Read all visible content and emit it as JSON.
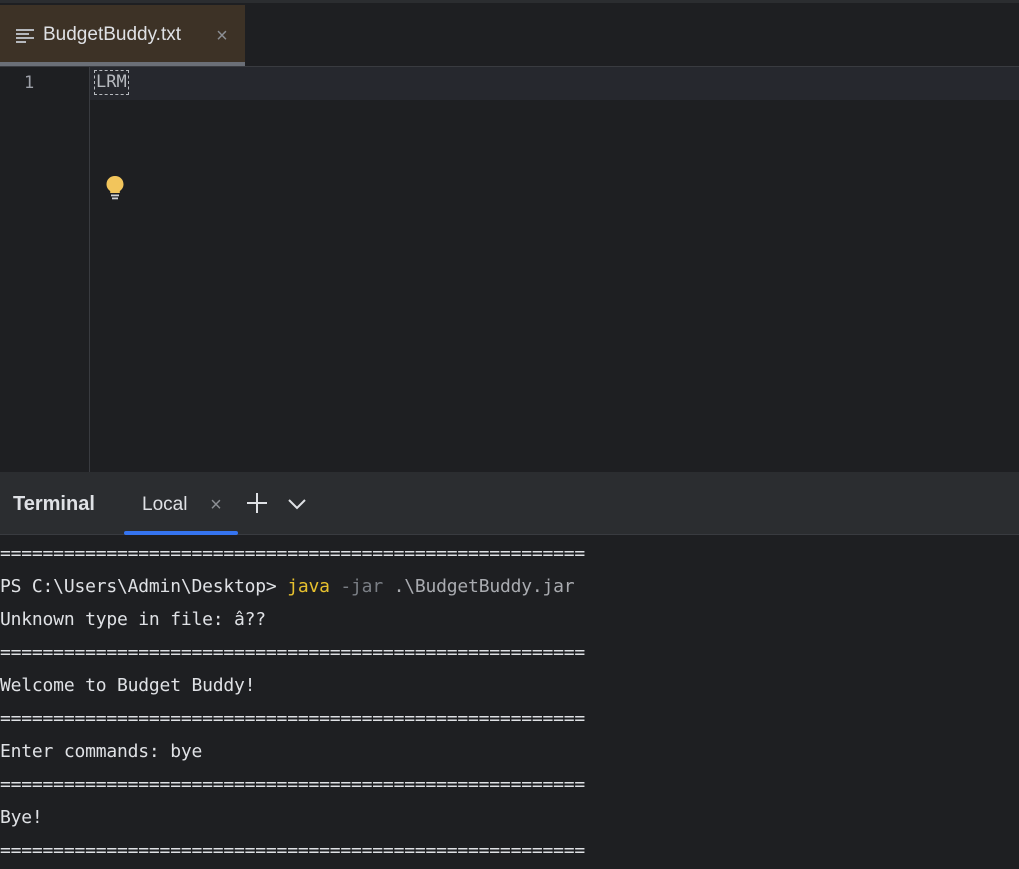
{
  "editor": {
    "tab": {
      "label": "BudgetBuddy.txt",
      "close_symbol": "×",
      "icon": "text-file-icon"
    },
    "line_number": "1",
    "lrm_marker": "LRM",
    "intention_icon": "lightbulb-icon"
  },
  "terminal": {
    "title": "Terminal",
    "tab_label": "Local",
    "tab_close_symbol": "×",
    "add_icon": "plus-icon",
    "dropdown_icon": "chevron-down-icon",
    "separator": "=======================================================",
    "prompt": "PS C:\\Users\\Admin\\Desktop> ",
    "command": "java",
    "flag": " -jar ",
    "argument": ".\\BudgetBuddy.jar",
    "lines": {
      "unknown_type": "Unknown type in file: â??",
      "welcome": "Welcome to Budget Buddy!",
      "enter_commands": "Enter commands: bye",
      "bye": "Bye!"
    }
  },
  "colors": {
    "background": "#1e1f22",
    "tab_active": "#3d3226",
    "accent": "#3574f0",
    "command_keyword": "#e6c02e",
    "bulb": "#f2c55c"
  }
}
